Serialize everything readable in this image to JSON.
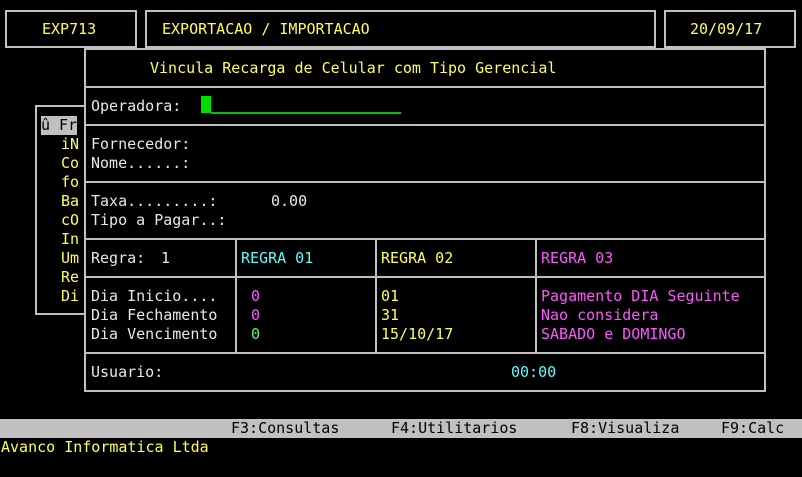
{
  "header": {
    "program_code": "EXP713",
    "module_title": "EXPORTACAO / IMPORTACAO",
    "date": "20/09/17"
  },
  "background_menu": {
    "items": [
      "û Fr",
      "iN",
      "Co",
      "fo",
      "Ba",
      "cO",
      "In",
      "Um",
      "Re",
      "Di"
    ]
  },
  "dialog": {
    "title": "Vincula Recarga de Celular com Tipo Gerencial",
    "operadora_label": "Operadora:",
    "operadora_value": "",
    "fornecedor_label": "Fornecedor:",
    "nome_label": "Nome......:",
    "taxa_label": "Taxa.........:",
    "taxa_value": "0.00",
    "tipo_pagar_label": "Tipo a Pagar..:",
    "regra_label": "Regra:",
    "regra_value": "1",
    "regra_headers": [
      "REGRA 01",
      "REGRA 02",
      "REGRA 03"
    ],
    "rows": [
      {
        "label": "Dia Inicio....",
        "r1": "0",
        "r2": "01",
        "r3": "Pagamento DIA Seguinte"
      },
      {
        "label": "Dia Fechamento",
        "r1": "0",
        "r2": "31",
        "r3": "Nao considera"
      },
      {
        "label": "Dia Vencimento",
        "r1": "0",
        "r2": "15/10/17",
        "r3": "SABADO e DOMINGO"
      }
    ],
    "usuario_label": "Usuario:",
    "usuario_time": "00:00"
  },
  "function_keys": [
    {
      "key": "F3:Consultas"
    },
    {
      "key": "F4:Utilitarios"
    },
    {
      "key": "F8:Visualiza"
    },
    {
      "key": "F9:Calc"
    }
  ],
  "footer": {
    "company": "Avanco Informatica Ltda"
  },
  "colors": {
    "background": "#000000",
    "border": "#c0c0c0",
    "label_yellow": "#ffff55",
    "regra01_cyan": "#55ffff",
    "regra03_magenta": "#ff55ff",
    "cursor_green": "#00e000"
  }
}
